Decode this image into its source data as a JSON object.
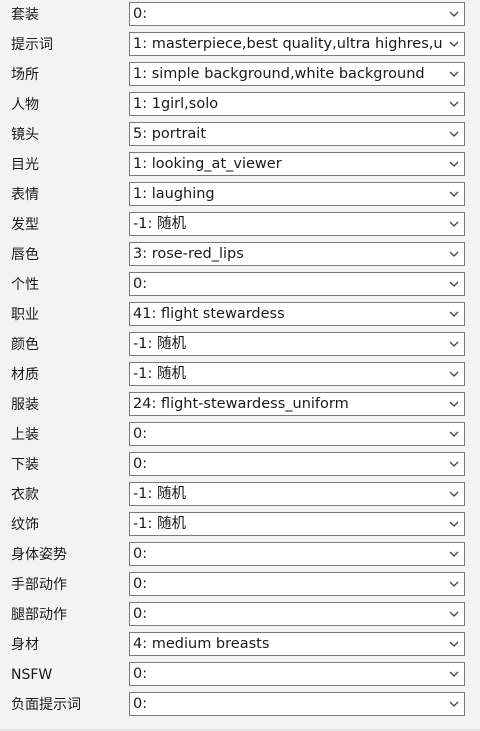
{
  "fields": [
    {
      "label": "套装",
      "value": "0:"
    },
    {
      "label": "提示词",
      "value": "1: masterpiece,best quality,ultra highres,u"
    },
    {
      "label": "场所",
      "value": "1: simple background,white background"
    },
    {
      "label": "人物",
      "value": "1: 1girl,solo"
    },
    {
      "label": "镜头",
      "value": "5: portrait"
    },
    {
      "label": "目光",
      "value": "1: looking_at_viewer"
    },
    {
      "label": "表情",
      "value": "1: laughing"
    },
    {
      "label": "发型",
      "value": "-1: 随机"
    },
    {
      "label": "唇色",
      "value": "3: rose-red_lips"
    },
    {
      "label": "个性",
      "value": "0:"
    },
    {
      "label": "职业",
      "value": "41: flight stewardess"
    },
    {
      "label": "颜色",
      "value": "-1: 随机"
    },
    {
      "label": "材质",
      "value": "-1: 随机"
    },
    {
      "label": "服装",
      "value": "24: flight-stewardess_uniform"
    },
    {
      "label": "上装",
      "value": "0:"
    },
    {
      "label": "下装",
      "value": "0:"
    },
    {
      "label": "衣款",
      "value": "-1: 随机"
    },
    {
      "label": "纹饰",
      "value": "-1: 随机"
    },
    {
      "label": "身体姿势",
      "value": "0:"
    },
    {
      "label": "手部动作",
      "value": "0:"
    },
    {
      "label": "腿部动作",
      "value": "0:"
    },
    {
      "label": "身材",
      "value": "4: medium breasts"
    },
    {
      "label": "NSFW",
      "value": "0:"
    },
    {
      "label": "负面提示词",
      "value": "0:"
    }
  ],
  "icons": {
    "dropdown": "chevron-down-icon"
  },
  "colors": {
    "background": "#f3f3f3",
    "field_bg": "#ffffff",
    "field_border": "#7a7a7a"
  }
}
